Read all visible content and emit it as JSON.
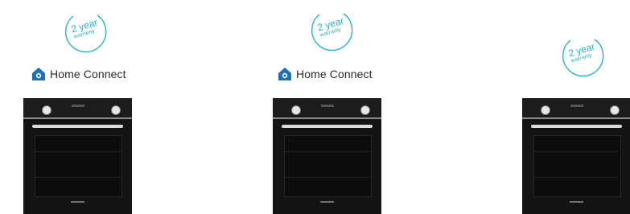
{
  "products": [
    {
      "badge": {
        "year_text": "2 year",
        "warranty_text": "warranty"
      },
      "brand_label": "Home Connect"
    },
    {
      "badge": {
        "year_text": "2 year",
        "warranty_text": "warranty"
      },
      "brand_label": "Home Connect"
    },
    {
      "badge": {
        "year_text": "2 year",
        "warranty_text": "warranty"
      }
    }
  ],
  "colors": {
    "badge_teal": "#2bb3bf",
    "home_connect_blue": "#1f6fb5",
    "oven_black": "#141414"
  }
}
